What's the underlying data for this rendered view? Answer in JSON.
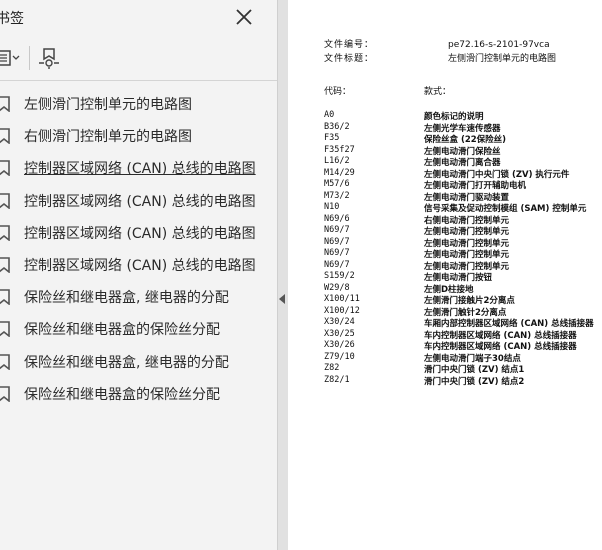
{
  "panel": {
    "title": "书签",
    "bookmarks": [
      {
        "label": "左侧滑门控制单元的电路图"
      },
      {
        "label": "右侧滑门控制单元的电路图"
      },
      {
        "label": "控制器区域网络 (CAN) 总线的电路图"
      },
      {
        "label": "控制器区域网络 (CAN) 总线的电路图"
      },
      {
        "label": "控制器区域网络 (CAN) 总线的电路图"
      },
      {
        "label": "控制器区域网络 (CAN) 总线的电路图"
      },
      {
        "label": "保险丝和继电器盒, 继电器的分配"
      },
      {
        "label": "保险丝和继电器盒的保险丝分配"
      },
      {
        "label": "保险丝和继电器盒, 继电器的分配"
      },
      {
        "label": "保险丝和继电器盒的保险丝分配"
      }
    ]
  },
  "document": {
    "file_number_label": "文件编号：",
    "file_number_value": "pe72.16-s-2101-97vca",
    "file_title_label": "文件标题：",
    "file_title_value": "左侧滑门控制单元的电路图",
    "code_header": "代码：",
    "desc_header": "款式：",
    "rows": [
      {
        "code": "A0",
        "desc": "颜色标记的说明"
      },
      {
        "code": "B36/2",
        "desc": "左侧光学车速传感器"
      },
      {
        "code": "F35",
        "desc": "保险丝盒 (22保险丝)"
      },
      {
        "code": "F35f27",
        "desc": "左侧电动滑门保险丝"
      },
      {
        "code": "L16/2",
        "desc": "左侧电动滑门离合器"
      },
      {
        "code": "M14/29",
        "desc": "左侧电动滑门中央门锁 (ZV) 执行元件"
      },
      {
        "code": "M57/6",
        "desc": "左侧电动滑门打开辅助电机"
      },
      {
        "code": "M73/2",
        "desc": "左侧电动滑门驱动装置"
      },
      {
        "code": "N10",
        "desc": "信号采集及促动控制模组 (SAM) 控制单元"
      },
      {
        "code": "N69/6",
        "desc": "右侧电动滑门控制单元"
      },
      {
        "code": "N69/7",
        "desc": "左侧电动滑门控制单元"
      },
      {
        "code": "N69/7",
        "desc": "左侧电动滑门控制单元"
      },
      {
        "code": "N69/7",
        "desc": "左侧电动滑门控制单元"
      },
      {
        "code": "N69/7",
        "desc": "左侧电动滑门控制单元"
      },
      {
        "code": "S159/2",
        "desc": "左侧电动滑门按钮"
      },
      {
        "code": "W29/8",
        "desc": "左侧D柱接地"
      },
      {
        "code": "X100/11",
        "desc": "左侧滑门接触片2分离点"
      },
      {
        "code": "X100/12",
        "desc": "左侧滑门触针2分离点"
      },
      {
        "code": "X30/24",
        "desc": "车厢内部控制器区域网络 (CAN) 总线插接器"
      },
      {
        "code": "X30/25",
        "desc": "车内控制器区域网络 (CAN) 总线插接器"
      },
      {
        "code": "X30/26",
        "desc": "车内控制器区域网络 (CAN) 总线插接器"
      },
      {
        "code": "Z79/10",
        "desc": "左侧电动滑门端子30结点"
      },
      {
        "code": "Z82",
        "desc": "滑门中央门锁 (ZV) 结点1"
      },
      {
        "code": "Z82/1",
        "desc": "滑门中央门锁 (ZV) 结点2"
      }
    ]
  }
}
